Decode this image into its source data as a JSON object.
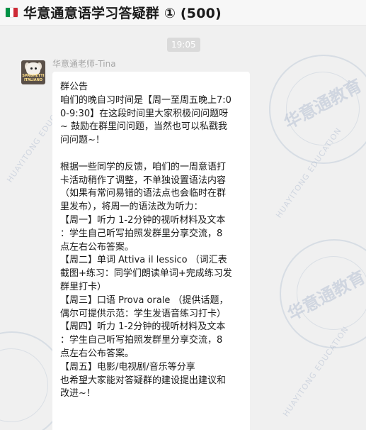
{
  "window": {
    "title": "华意通意语学习答疑群 ① (500)",
    "flag_colors": [
      "#009246",
      "#ffffff",
      "#ce2b37"
    ]
  },
  "watermark": {
    "brand_cn": "华意通教育",
    "brand_en": "HUAYITONG EDUCATION"
  },
  "chat": {
    "timestamp": "19:05",
    "message": {
      "sender": "华意通老师-Tina",
      "avatar_caption": "SPAGHETTI ITALIANO",
      "lines": [
        "群公告",
        "咱们的晚自习时间是【周一至周五晚上7:0",
        "0-9:30】在这段时间里大家积极问问题呀",
        "~ 鼓励在群里问问题，当然也可以私戳我",
        "问问题~！",
        "",
        "根据一些同学的反馈，咱们的一周意语打",
        "卡活动稍作了调整，不单独设置语法内容",
        "（如果有常问易错的语法点也会临时在群",
        "里发布），将周一的语法改为听力：",
        "【周一】听力  1-2分钟的视听材料及文本",
        "：学生自己听写拍照发群里分享交流，8",
        "点左右公布答案。",
        "【周二】单词  Attiva il lessico  （词汇表",
        "截图+练习：同学们朗读单词+完成练习发",
        "群里打卡）",
        "【周三】口语  Prova orale  （提供话题，",
        "偶尔可提供示范：学生发语音练习打卡）",
        "【周四】听力  1-2分钟的视听材料及文本",
        "：学生自己听写拍照发群里分享交流，8",
        "点左右公布答案。",
        "【周五】电影/电视剧/音乐等分享",
        "也希望大家能对答疑群的建设提出建议和",
        "改进~！"
      ]
    }
  }
}
